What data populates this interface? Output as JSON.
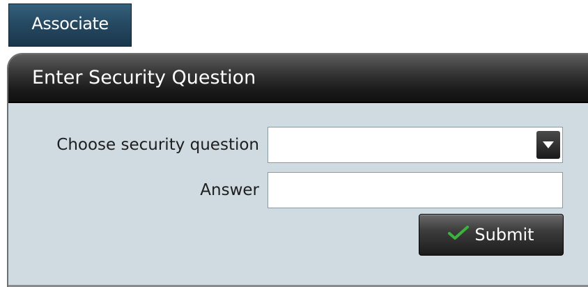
{
  "associate_button": {
    "label": "Associate"
  },
  "dialog": {
    "title": "Enter Security Question",
    "question_label": "Choose security question",
    "question_value": "",
    "answer_label": "Answer",
    "answer_value": "",
    "submit_label": "Submit",
    "submit_icon": "checkmark-icon"
  },
  "colors": {
    "associate_bg": "#264a63",
    "panel_bg": "#cfdbe0",
    "header_bg": "#1a1a1a",
    "check_green": "#3cb43c"
  }
}
